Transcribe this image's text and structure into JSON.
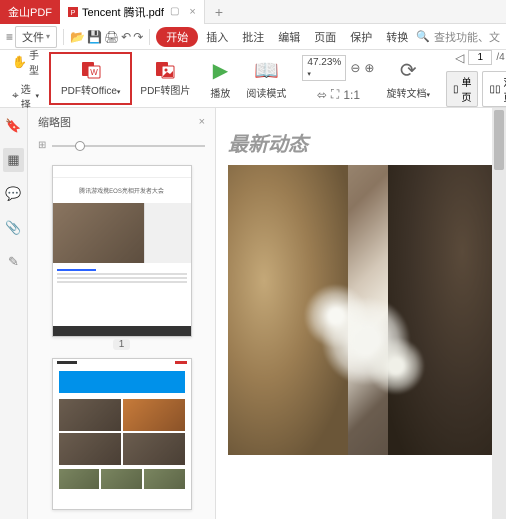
{
  "app": {
    "title": "金山PDF"
  },
  "tab": {
    "name": "Tencent 腾讯.pdf"
  },
  "menu": {
    "file": "文件",
    "start": "开始",
    "items": [
      "插入",
      "批注",
      "编辑",
      "页面",
      "保护",
      "转换"
    ],
    "search": "查找功能、文"
  },
  "toolbar": {
    "hand": "手型",
    "select": "选择",
    "pdf_to_office": "PDF转Office",
    "pdf_to_image": "PDF转图片",
    "play": "播放",
    "read_mode": "阅读模式",
    "zoom_value": "47.23%",
    "rotate_doc": "旋转文档",
    "page_current": "1",
    "page_total": "/4",
    "single_page": "单页",
    "double_page": "双页"
  },
  "thumbnails": {
    "title": "缩略图",
    "page1": "1"
  },
  "content": {
    "heading": "最新动态"
  }
}
